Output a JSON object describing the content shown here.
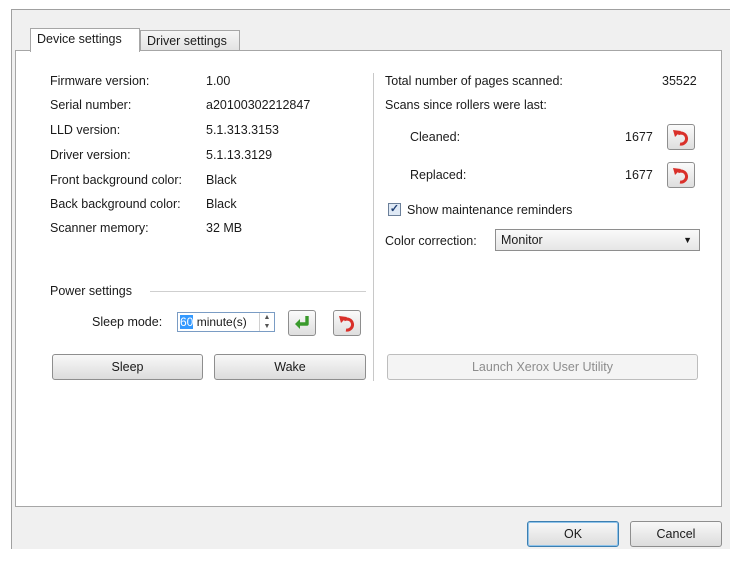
{
  "tabs": [
    {
      "label": "Device settings",
      "active": true
    },
    {
      "label": "Driver settings",
      "active": false
    }
  ],
  "device_info": [
    {
      "label": "Firmware version:",
      "value": "1.00"
    },
    {
      "label": "Serial number:",
      "value": "a20100302212847"
    },
    {
      "label": "LLD version:",
      "value": "5.1.313.3153"
    },
    {
      "label": "Driver version:",
      "value": "5.1.13.3129"
    },
    {
      "label": "Front background color:",
      "value": "Black"
    },
    {
      "label": "Back background color:",
      "value": "Black"
    },
    {
      "label": "Scanner memory:",
      "value": "32 MB"
    }
  ],
  "power": {
    "title": "Power settings",
    "sleep_label": "Sleep mode:",
    "sleep_value_selected": "60",
    "sleep_unit": " minute(s)",
    "sleep_button": "Sleep",
    "wake_button": "Wake"
  },
  "stats": {
    "total_label": "Total number of pages scanned:",
    "total_value": "35522",
    "rollers_label": "Scans since rollers were last:",
    "cleaned_label": "Cleaned:",
    "cleaned_value": "1677",
    "replaced_label": "Replaced:",
    "replaced_value": "1677"
  },
  "maintenance": {
    "checked": true,
    "label": "Show maintenance reminders"
  },
  "color_correction": {
    "label": "Color correction:",
    "value": "Monitor"
  },
  "launch_button": "Launch Xerox User Utility",
  "footer": {
    "ok": "OK",
    "cancel": "Cancel"
  },
  "icons": {
    "apply": "apply-green-arrow-icon",
    "reset": "reset-red-arrow-icon"
  },
  "colors": {
    "accent_red": "#d9302a",
    "accent_green": "#3a9a2c",
    "selection_blue": "#3399ff"
  }
}
